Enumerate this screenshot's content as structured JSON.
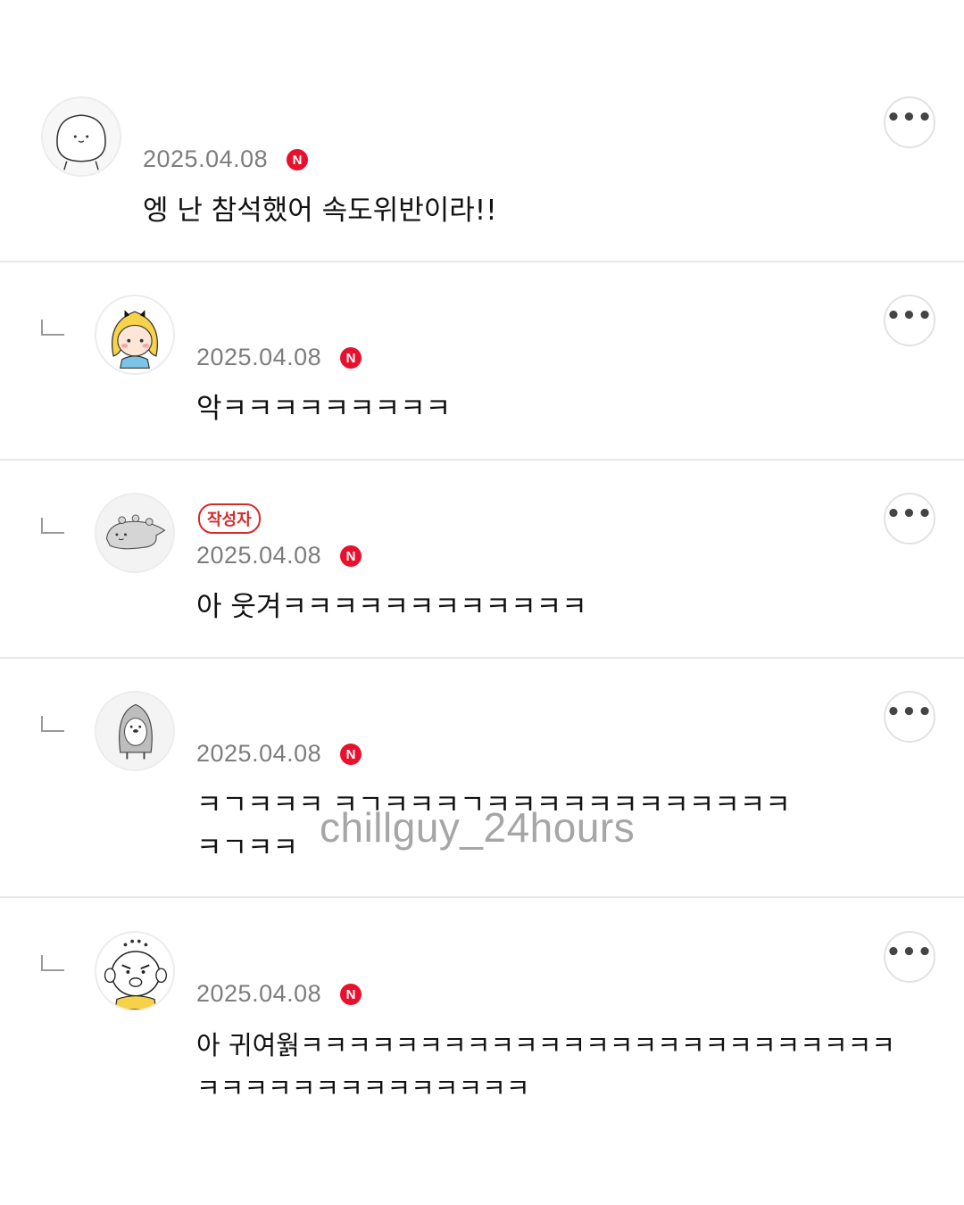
{
  "colors": {
    "new_badge": "#e8112d",
    "author_badge": "#d42a2a",
    "date_text": "#7d7d7d",
    "divider": "#e9e9e9"
  },
  "comments": [
    {
      "date": "2025.04.08",
      "new_badge": "N",
      "text": "엥 난 참석했어 속도위반이라!!",
      "avatar_icon": "white-blob-character-avatar",
      "more_icon": "more-options-icon",
      "more_label": "•••"
    },
    {
      "date": "2025.04.08",
      "new_badge": "N",
      "text": "악ㅋㅋㅋㅋㅋㅋㅋㅋㅋ",
      "avatar_icon": "blonde-girl-character-avatar",
      "more_icon": "more-options-icon",
      "more_label": "•••"
    },
    {
      "author_label": "작성자",
      "date": "2025.04.08",
      "new_badge": "N",
      "text": "아  웃겨ㅋㅋㅋㅋㅋㅋㅋㅋㅋㅋㅋㅋ",
      "avatar_icon": "gray-dinosaur-character-avatar",
      "more_icon": "more-options-icon",
      "more_label": "•••"
    },
    {
      "date": "2025.04.08",
      "new_badge": "N",
      "text": "ㅋㄱㅋㅋㅋ ㅋㄱㅋㅋㅋㄱㅋㅋㅋㅋㅋㅋㅋㅋㅋㅋㅋㅋ\nㅋㄱㅋㅋ",
      "avatar_icon": "penguin-character-avatar",
      "more_icon": "more-options-icon",
      "more_label": "•••"
    },
    {
      "date": "2025.04.08",
      "new_badge": "N",
      "text": "아 귀여웕ㅋㅋㅋㅋㅋㅋㅋㅋㅋㅋㅋㅋㅋㅋㅋㅋㅋㅋㅋㅋㅋㅋㅋㅋㅋ\nㅋㅋㅋㅋㅋㅋㅋㅋㅋㅋㅋㅋㅋㅋ",
      "avatar_icon": "bald-baby-character-avatar",
      "more_icon": "more-options-icon",
      "more_label": "•••"
    }
  ],
  "watermark": "chillguy_24hours"
}
